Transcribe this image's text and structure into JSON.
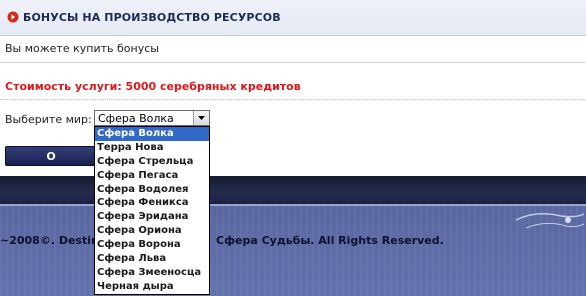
{
  "header": {
    "title": "БОНУСЫ НА ПРОИЗВОДСТВО РЕСУРСОВ",
    "bullet_icon": "arrow-bullet-icon"
  },
  "intro_text": "Вы можете купить бонусы",
  "cost_text": "Стоимость услуги: 5000 серебряных кредитов",
  "world_select": {
    "label": "Выберите мир:",
    "value": "Сфера Волка",
    "options": [
      "Сфера Волка",
      "Терра Нова",
      "Сфера Стрельца",
      "Сфера Пегаса",
      "Сфера Водолея",
      "Сфера Феникса",
      "Сфера Эридана",
      "Сфера Ориона",
      "Сфера Ворона",
      "Сфера Льва",
      "Сфера Змееносца",
      "Черная дыра"
    ],
    "highlighted_index": 0
  },
  "ok_button": {
    "label": "О"
  },
  "footer": {
    "copyright_left": "~2008©. Destiny",
    "copyright_right": "Сфера Судьбы. All Rights Reserved."
  },
  "colors": {
    "cost_red": "#e0161a",
    "header_text": "#1c2a55",
    "selection_blue": "#3169c6",
    "footer_bg": "#5f6ea7",
    "footer_band": "#1f2444"
  }
}
